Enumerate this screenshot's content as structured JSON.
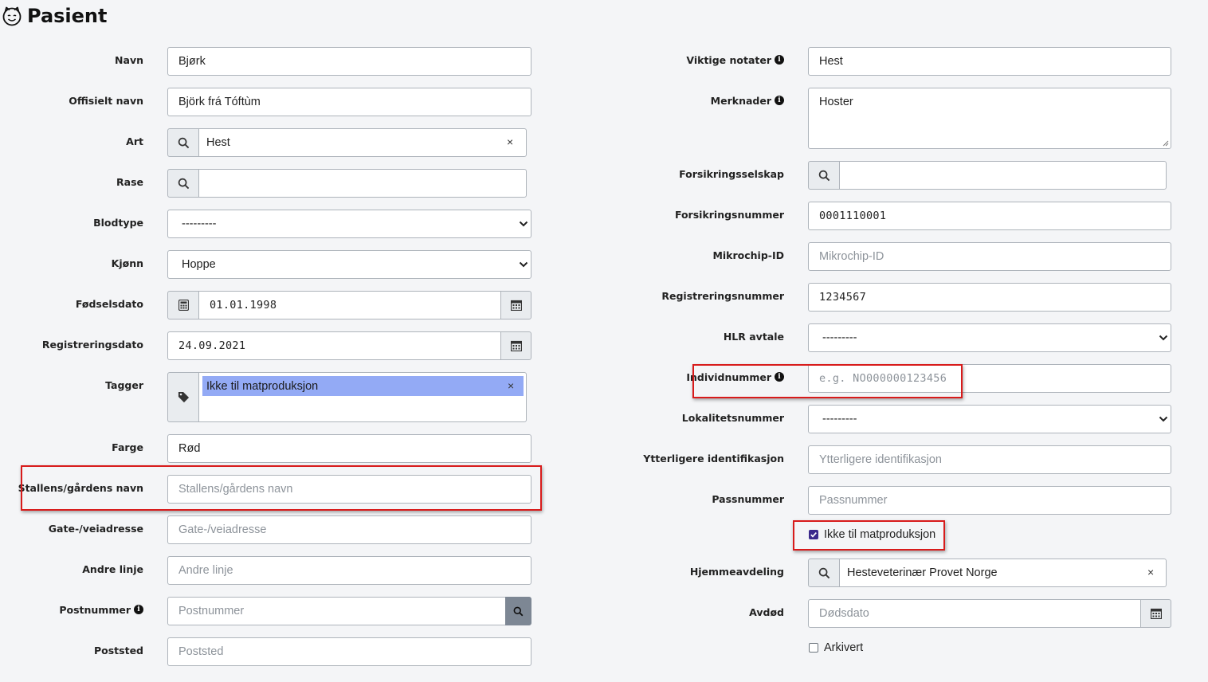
{
  "page": {
    "title": "Pasient",
    "title_icon": "cat-face-icon"
  },
  "left": {
    "navn": {
      "label": "Navn",
      "value": "Bjørk"
    },
    "offisielt_navn": {
      "label": "Offisielt navn",
      "value": "Björk frá Tóftùm"
    },
    "art": {
      "label": "Art",
      "value": "Hest",
      "clear": "×"
    },
    "rase": {
      "label": "Rase",
      "value": ""
    },
    "blodtype": {
      "label": "Blodtype",
      "value": "---------"
    },
    "kjonn": {
      "label": "Kjønn",
      "value": "Hoppe"
    },
    "fodselsdato": {
      "label": "Fødselsdato",
      "value": "01.01.1998"
    },
    "registreringsdato": {
      "label": "Registreringsdato",
      "value": "24.09.2021"
    },
    "tagger": {
      "label": "Tagger",
      "tag": "Ikke til matproduksjon",
      "clear": "×"
    },
    "farge": {
      "label": "Farge",
      "value": "Rød"
    },
    "stallens_navn": {
      "label": "Stallens/gårdens navn",
      "placeholder": "Stallens/gårdens navn"
    },
    "gateadresse": {
      "label": "Gate-/veiadresse",
      "placeholder": "Gate-/veiadresse"
    },
    "andre_linje": {
      "label": "Andre linje",
      "placeholder": "Andre linje"
    },
    "postnummer": {
      "label": "Postnummer",
      "placeholder": "Postnummer"
    },
    "poststed": {
      "label": "Poststed",
      "placeholder": "Poststed"
    }
  },
  "right": {
    "viktige_notater": {
      "label": "Viktige notater",
      "value": "Hest"
    },
    "merknader": {
      "label": "Merknader",
      "value": "Hoster"
    },
    "forsikringsselskap": {
      "label": "Forsikringsselskap",
      "value": ""
    },
    "forsikringsnummer": {
      "label": "Forsikringsnummer",
      "value": "0001110001"
    },
    "mikrochip": {
      "label": "Mikrochip-ID",
      "placeholder": "Mikrochip-ID"
    },
    "registreringsnummer": {
      "label": "Registreringsnummer",
      "value": "1234567"
    },
    "hlr_avtale": {
      "label": "HLR avtale",
      "value": "---------"
    },
    "individnummer": {
      "label": "Individnummer",
      "placeholder": "e.g. NO000000123456"
    },
    "lokalitetsnummer": {
      "label": "Lokalitetsnummer",
      "value": "---------"
    },
    "ytterligere": {
      "label": "Ytterligere identifikasjon",
      "placeholder": "Ytterligere identifikasjon"
    },
    "passnummer": {
      "label": "Passnummer",
      "placeholder": "Passnummer"
    },
    "ikke_mat": {
      "label": "Ikke til matproduksjon",
      "checked": true
    },
    "hjemmeavdeling": {
      "label": "Hjemmeavdeling",
      "value": "Hesteveterinær Provet Norge",
      "clear": "×"
    },
    "avdod": {
      "label": "Avdød",
      "placeholder": "Dødsdato"
    },
    "arkivert": {
      "label": "Arkivert",
      "checked": false
    }
  },
  "colors": {
    "highlight": "#d81b1b",
    "tag_chip": "#93aaf5",
    "checkbox_checked": "#3b2a8c"
  }
}
